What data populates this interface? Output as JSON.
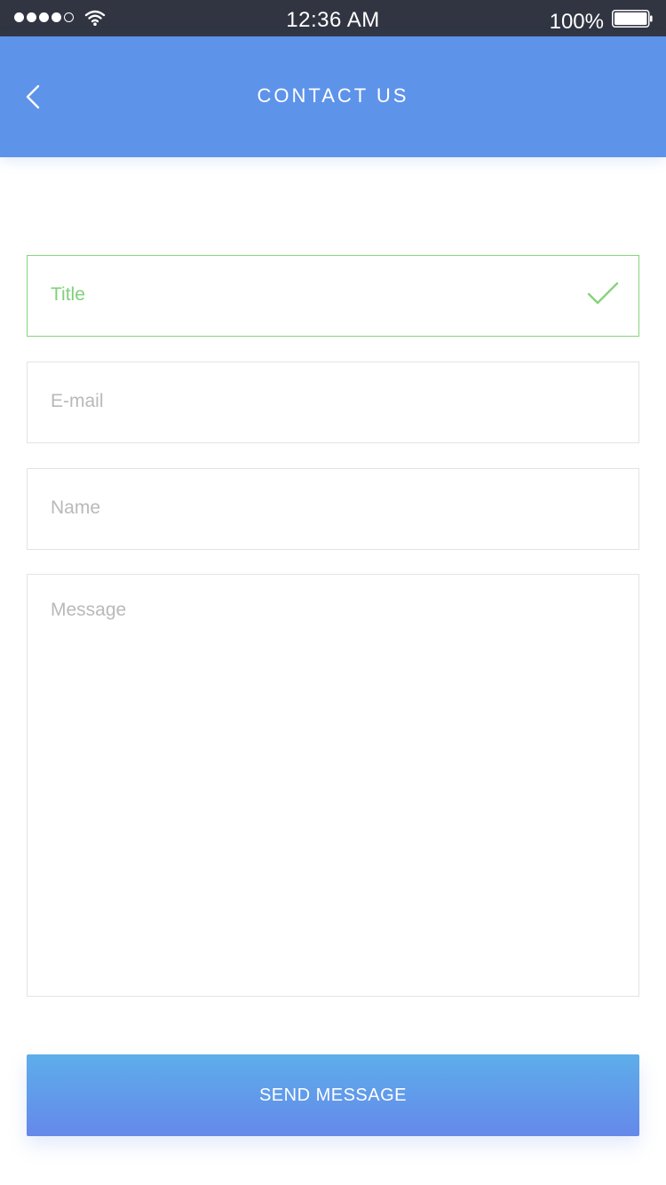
{
  "status_bar": {
    "time": "12:36 AM",
    "battery_percent": "100%",
    "signal_bars_filled": 4,
    "signal_bars_total": 5,
    "battery_level": 1.0
  },
  "header": {
    "title": "CONTACT US",
    "back_icon": "chevron-left-icon",
    "background_color": "#5e93ea"
  },
  "form": {
    "title_field": {
      "value": "Title",
      "valid": true,
      "status_icon": "check-icon",
      "valid_color": "#86d47b"
    },
    "email_field": {
      "placeholder": "E-mail",
      "value": ""
    },
    "name_field": {
      "placeholder": "Name",
      "value": ""
    },
    "message_field": {
      "placeholder": "Message",
      "value": ""
    }
  },
  "send_button": {
    "label": "SEND MESSAGE",
    "gradient_top": "#5daeea",
    "gradient_bottom": "#6588ea"
  }
}
